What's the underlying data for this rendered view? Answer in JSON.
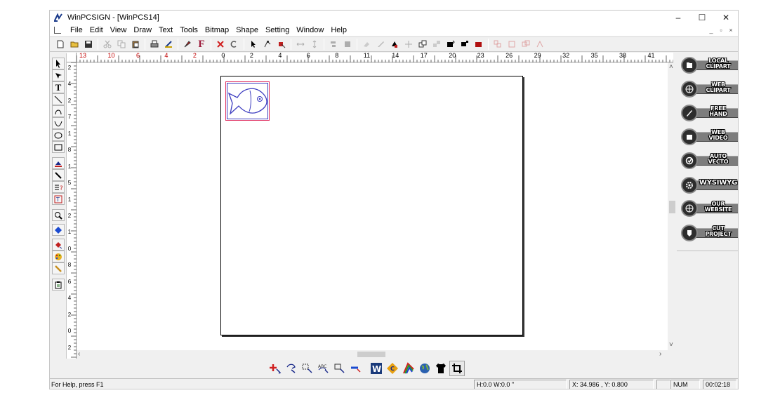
{
  "window": {
    "title": "WinPCSIGN - [WinPCS14]",
    "controls": {
      "minimize": "–",
      "maximize": "☐",
      "close": "✕"
    }
  },
  "menubar": {
    "items": [
      "File",
      "Edit",
      "View",
      "Draw",
      "Text",
      "Tools",
      "Bitmap",
      "Shape",
      "Setting",
      "Window",
      "Help"
    ],
    "mdi_controls": [
      "_",
      "▫",
      "×"
    ]
  },
  "toolbar": {
    "font_button_letter": "F"
  },
  "ruler": {
    "top_labels": [
      {
        "text": "13",
        "negative": true
      },
      {
        "text": "10",
        "negative": true
      },
      {
        "text": "6",
        "negative": true
      },
      {
        "text": "4",
        "negative": true
      },
      {
        "text": "2",
        "negative": true
      },
      {
        "text": "0",
        "negative": false
      },
      {
        "text": "2",
        "negative": false
      },
      {
        "text": "4",
        "negative": false
      },
      {
        "text": "6",
        "negative": false
      },
      {
        "text": "8",
        "negative": false
      },
      {
        "text": "11",
        "negative": false
      },
      {
        "text": "14",
        "negative": false
      },
      {
        "text": "17",
        "negative": false
      },
      {
        "text": "20",
        "negative": false
      },
      {
        "text": "23",
        "negative": false
      },
      {
        "text": "26",
        "negative": false
      },
      {
        "text": "29",
        "negative": false
      },
      {
        "text": "32",
        "negative": false
      },
      {
        "text": "35",
        "negative": false
      },
      {
        "text": "38",
        "negative": false
      },
      {
        "text": "41",
        "negative": false
      }
    ],
    "left_labels": [
      "2",
      "4",
      "2",
      "7",
      "1",
      "8",
      "1",
      "5",
      "1",
      "2",
      "1",
      "0",
      "8",
      "6",
      "4",
      "2",
      "0",
      "2"
    ]
  },
  "right_panel": {
    "buttons": [
      {
        "label_1": "LOCAL",
        "label_2": "CLIPART",
        "icon": "folder-icon"
      },
      {
        "label_1": "WEB",
        "label_2": "CLIPART",
        "icon": "globe-icon"
      },
      {
        "label_1": "FREE",
        "label_2": "HAND",
        "icon": "pen-icon"
      },
      {
        "label_1": "WEB",
        "label_2": "VIDEO",
        "icon": "video-icon"
      },
      {
        "label_1": "AUTO",
        "label_2": "VECTO",
        "icon": "vector-icon"
      },
      {
        "label_1": "WYSIWYG",
        "label_2": "",
        "icon": "gear-icon"
      },
      {
        "label_1": "OUR",
        "label_2": "WEBSITE",
        "icon": "globe-icon"
      },
      {
        "label_1": "CUT",
        "label_2": "PROJECT",
        "icon": "cut-icon"
      }
    ]
  },
  "statusbar": {
    "help": "For Help, press F1",
    "size": "H:0.0  W:0.0 \"",
    "coords": "X: 34.986 , Y: 0.800",
    "num": "NUM",
    "time": "00:02:18"
  },
  "colors": {
    "selection_outer": "#e03060",
    "selection_inner": "#3d3dc0",
    "fish_stroke": "#3d3dc0"
  }
}
